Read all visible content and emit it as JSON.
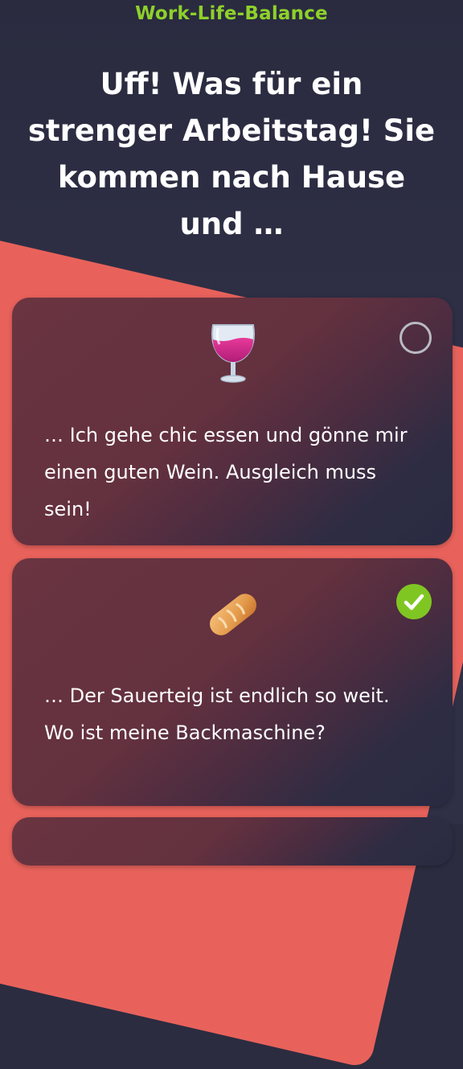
{
  "header": {
    "category": "Work-Life-Balance",
    "question": "Uff! Was für ein strenger Arbeitstag! Sie kommen nach Hause und …"
  },
  "options": [
    {
      "icon": "wine-glass-icon",
      "text": "… Ich gehe chic essen und gönne mir einen guten Wein. Ausgleich muss sein!",
      "selected": false
    },
    {
      "icon": "bread-icon",
      "text": "… Der Sauerteig ist endlich so weit. Wo ist meine Backmaschine?",
      "selected": true
    }
  ],
  "colors": {
    "background": "#2b2c40",
    "accent_coral": "#e8625b",
    "category_green": "#8ed12a",
    "check_green": "#80c623",
    "card": "#64313f"
  }
}
